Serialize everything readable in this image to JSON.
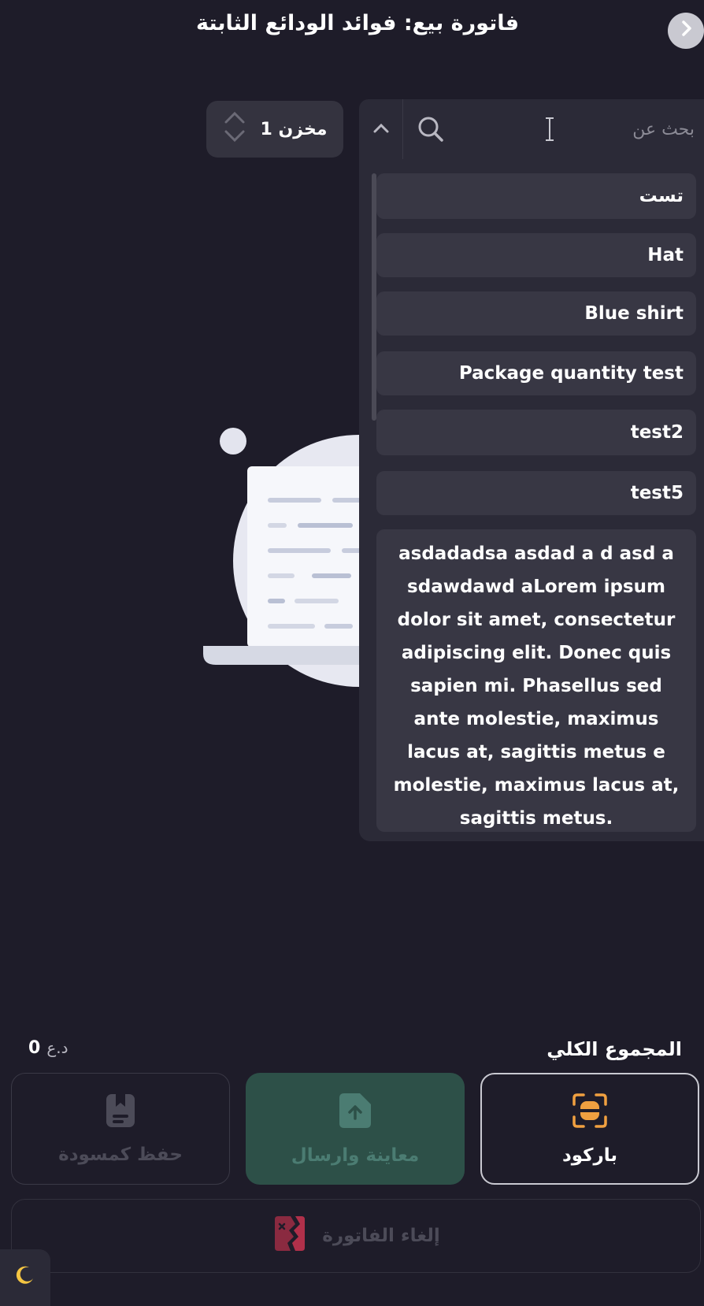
{
  "header": {
    "title": "فاتورة بيع: فوائد الودائع الثابتة",
    "back_icon": "chevron-right-icon"
  },
  "search": {
    "placeholder": "بحث عن",
    "value": ""
  },
  "warehouse": {
    "label": "مخزن 1"
  },
  "dropdown": {
    "items": [
      {
        "label": "تست"
      },
      {
        "label": "Hat"
      },
      {
        "label": "Blue shirt"
      },
      {
        "label": "Package quantity test"
      },
      {
        "label": "test2"
      },
      {
        "label": "test5"
      },
      {
        "label": "asdadadsa asdad a d asd a sdawdawd aLorem ipsum dolor sit amet, consectetur adipiscing elit. Donec quis sapien mi. Phasellus sed ante molestie, maximus lacus at, sagittis metus e molestie, maximus lacus at, sagittis metus."
      }
    ]
  },
  "totals": {
    "label": "المجموع الكلي",
    "value": "0",
    "currency": "د.ع"
  },
  "actions": {
    "barcode_label": "باركود",
    "preview_label": "معاينة وارسال",
    "draft_label": "حفظ كمسودة",
    "cancel_label": "إلغاء الفاتورة"
  },
  "colors": {
    "background": "#1e1c29",
    "panel": "#2b2a37",
    "item": "#383744",
    "barcode_accent": "#f0a040",
    "preview_bg": "#2d5048",
    "cancel_accent": "#b0304a"
  }
}
